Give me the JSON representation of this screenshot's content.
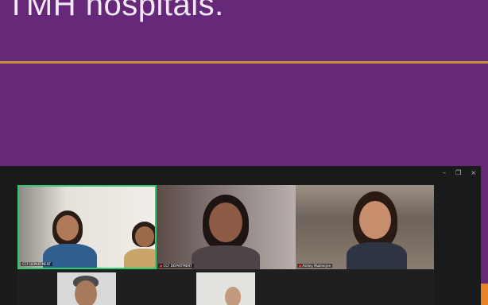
{
  "slide": {
    "title": "TMH hospitals."
  },
  "window": {
    "controls": {
      "minimize": "–",
      "restore": "❐",
      "close": "×"
    }
  },
  "participants": [
    {
      "name": "CCF DEPARTMENT",
      "speaking": true,
      "muted": false
    },
    {
      "name": "CCF DEPARTMENT",
      "speaking": false,
      "muted": true
    },
    {
      "name": "Ashley Mukherjee",
      "speaking": false,
      "muted": true
    },
    {
      "name": "",
      "speaking": false,
      "muted": false
    },
    {
      "name": "",
      "speaking": false,
      "muted": false
    }
  ],
  "colors": {
    "slide_bg": "#66297a",
    "title_rule": "#c8923a",
    "active_speaker_border": "#2ecc71",
    "side_tab": "#e8832a"
  }
}
